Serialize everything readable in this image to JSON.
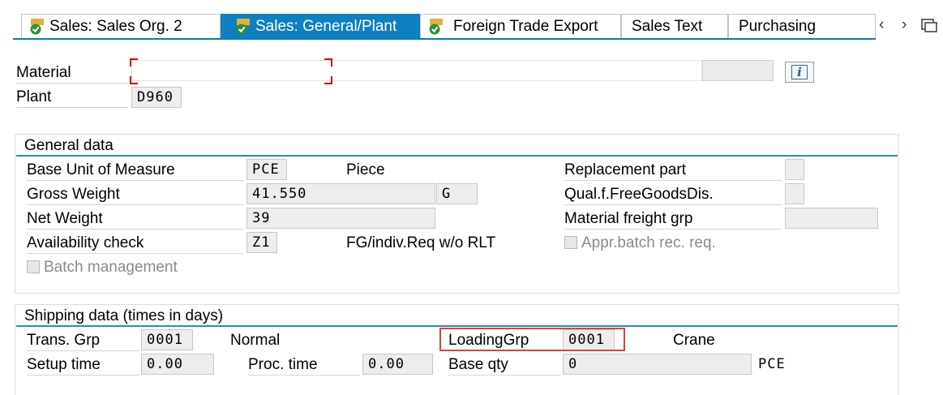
{
  "tabs": [
    {
      "label": "Sales: Sales Org. 2",
      "icon": "check-doc-icon"
    },
    {
      "label": "Sales: General/Plant",
      "icon": "check-doc-icon"
    },
    {
      "label": "Foreign Trade Export",
      "icon": "check-doc-icon"
    },
    {
      "label": "Sales Text"
    },
    {
      "label": "Purchasing"
    }
  ],
  "nav": {
    "prev": "‹",
    "next": "›",
    "menu_icon": "tab-list-icon"
  },
  "header": {
    "material_label": "Material",
    "material_value": "",
    "info_button": "i",
    "plant_label": "Plant",
    "plant_value": "D960"
  },
  "general": {
    "title": "General data",
    "base_uom_label": "Base Unit of Measure",
    "base_uom_value": "PCE",
    "base_uom_text": "Piece",
    "gross_weight_label": "Gross Weight",
    "gross_weight_value": "41.550",
    "weight_unit": "G",
    "net_weight_label": "Net Weight",
    "net_weight_value": "39",
    "availability_label": "Availability check",
    "availability_value": "Z1",
    "availability_text": "FG/indiv.Req w/o RLT",
    "batch_label": "Batch management",
    "replacement_label": "Replacement part",
    "qual_label": "Qual.f.FreeGoodsDis.",
    "freight_label": "Material freight grp",
    "appr_batch_label": "Appr.batch rec. req."
  },
  "shipping": {
    "title": "Shipping data (times in days)",
    "trans_grp_label": "Trans. Grp",
    "trans_grp_value": "0001",
    "trans_grp_text": "Normal",
    "loading_grp_label": "LoadingGrp",
    "loading_grp_value": "0001",
    "loading_grp_text": "Crane",
    "setup_label": "Setup time",
    "setup_value": "0.00",
    "proc_label": "Proc. time",
    "proc_value": "0.00",
    "base_qty_label": "Base qty",
    "base_qty_value": "0",
    "base_qty_unit": "PCE"
  },
  "colors": {
    "accent": "#0e7fc0",
    "highlight": "#e0403a",
    "required": "#cc0000"
  }
}
